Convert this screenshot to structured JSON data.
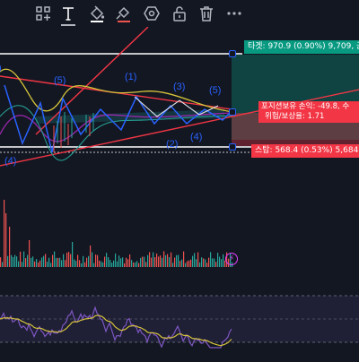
{
  "toolbar": {
    "tools": [
      {
        "name": "plus-grid-icon"
      },
      {
        "name": "text-tool-icon",
        "glyph": "T",
        "active": true
      },
      {
        "name": "paint-bucket-icon"
      },
      {
        "name": "brush-bucket-icon"
      },
      {
        "name": "settings-hex-icon"
      },
      {
        "name": "unlock-icon"
      },
      {
        "name": "trash-icon"
      },
      {
        "name": "more-icon",
        "glyph": "•••"
      }
    ]
  },
  "position": {
    "target_label": "타겟: 970.9 (0.90%) 9,709, 금",
    "stop_label": "스탑: 568.4 (0.53%) 5,684, 금",
    "pnl_line1": "포지션보유 손익: -49.8, 수",
    "pnl_line2": "위험/보상율: 1.71"
  },
  "waves": {
    "labels": [
      "(5)",
      "(1)",
      "(3)",
      "(5)",
      "(2)",
      "(4)",
      "(4)",
      ")"
    ]
  },
  "colors": {
    "target_green": "#089981",
    "stop_red": "#f23645",
    "trend_red": "#f23645",
    "wave_blue": "#2962ff",
    "ma_yellow": "#d4c33a",
    "ma_purple": "#9c27b0",
    "rsi_purple": "#7e57c2"
  }
}
